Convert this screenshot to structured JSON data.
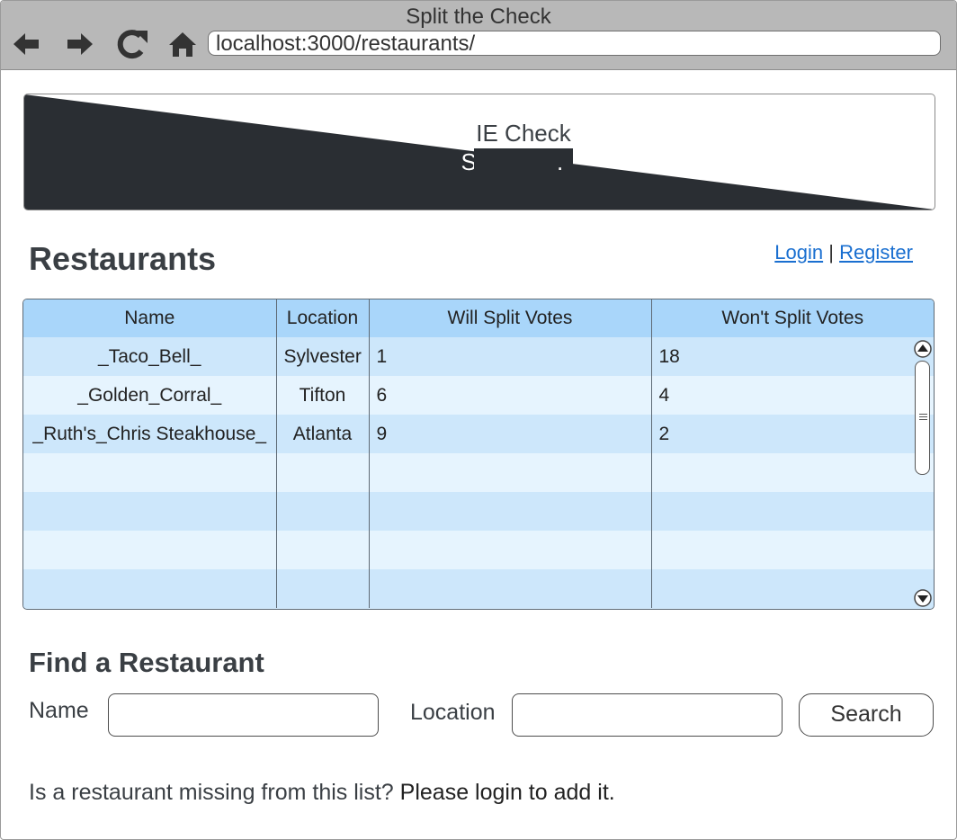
{
  "window": {
    "title": "Split the Check"
  },
  "browser": {
    "address": "localhost:3000/restaurants/",
    "icons": [
      "back-arrow-icon",
      "forward-arrow-icon",
      "reload-icon",
      "home-icon"
    ]
  },
  "banner": {
    "line1": "IE Check",
    "line2": "Split TF",
    "tail": "."
  },
  "page": {
    "title": "Restaurants"
  },
  "auth": {
    "login": "Login",
    "sep": "|",
    "register": "Register"
  },
  "table": {
    "headers": [
      "Name",
      "Location",
      "Will Split Votes",
      "Won't Split Votes"
    ],
    "rows": [
      [
        "_Taco_Bell_",
        "Sylvester",
        "1",
        "18"
      ],
      [
        "_Golden_Corral_",
        "Tifton",
        "6",
        "4"
      ],
      [
        "_Ruth's_Chris Steakhouse_",
        "Atlanta",
        "9",
        "2"
      ],
      [
        "",
        "",
        "",
        ""
      ],
      [
        "",
        "",
        "",
        ""
      ],
      [
        "",
        "",
        "",
        ""
      ],
      [
        "",
        "",
        "",
        ""
      ]
    ]
  },
  "find": {
    "title": "Find a Restaurant",
    "name_label": "Name",
    "name_value": "",
    "location_label": "Location",
    "location_value": "",
    "search_label": "Search"
  },
  "footer": {
    "question": "Is a restaurant missing from this list?",
    "cta": "Please login to add it."
  },
  "colors": {
    "header_bg": "#a9d6fa",
    "row_odd": "#cde7fb",
    "row_even": "#e6f4fe",
    "banner_dark": "#2a2e33",
    "link": "#1a6fd0"
  }
}
